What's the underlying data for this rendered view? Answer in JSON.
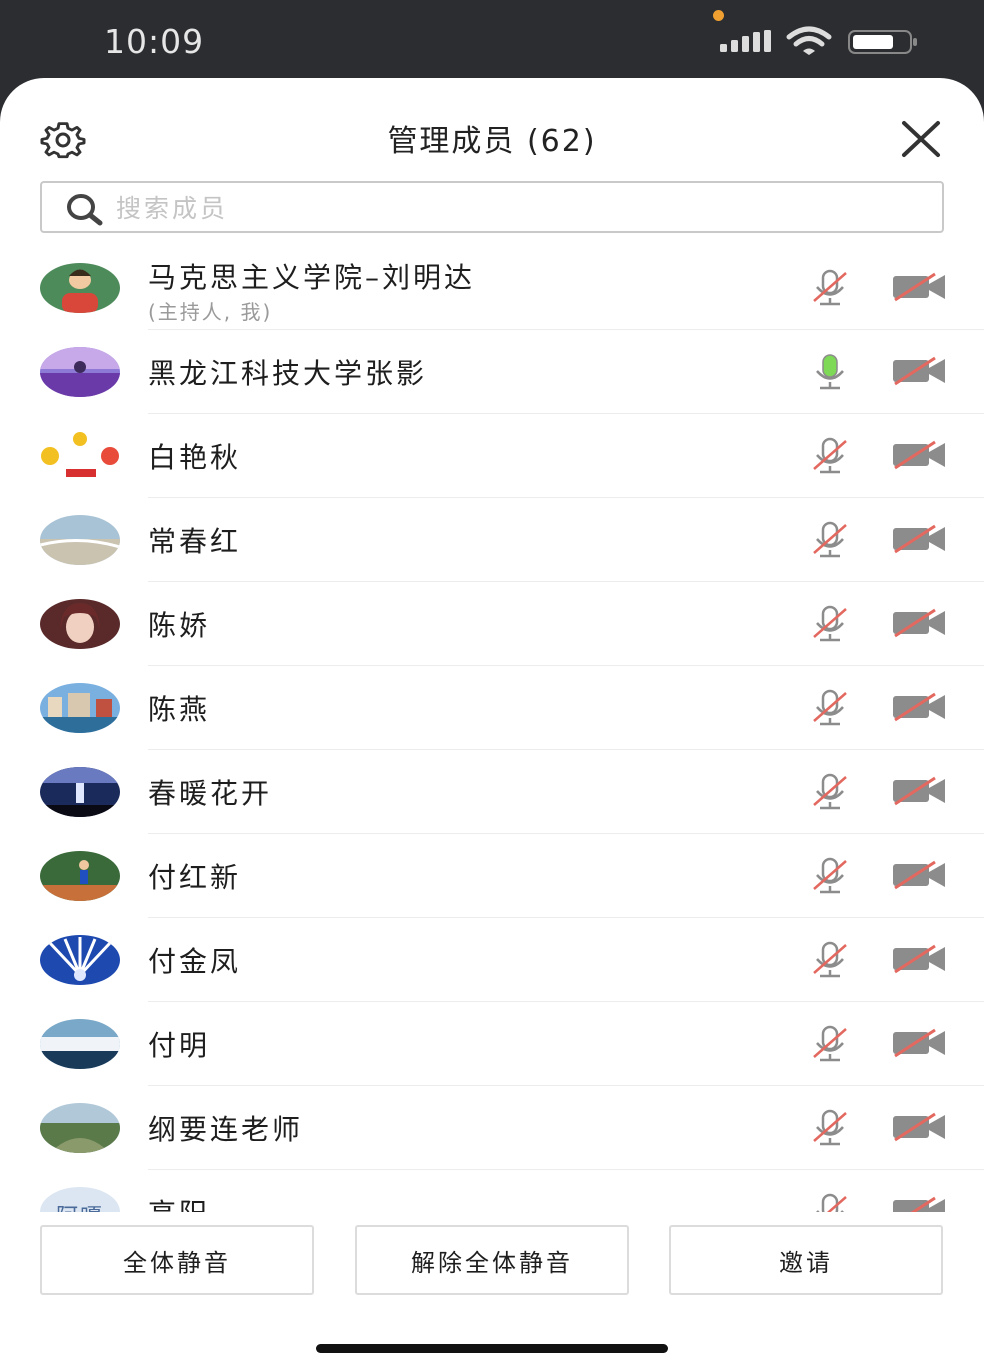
{
  "status_bar": {
    "time": "10:09"
  },
  "header": {
    "title": "管理成员 (62)"
  },
  "search": {
    "placeholder": "搜索成员"
  },
  "colors": {
    "mic_on": "#7ed957",
    "muted_slash": "#e3685f",
    "icon_gray": "#8c8c8c"
  },
  "members": [
    {
      "name": "马克思主义学院–刘明达",
      "subtitle": "(主持人, 我)",
      "mic": "muted",
      "camera": "off"
    },
    {
      "name": "黑龙江科技大学张影",
      "mic": "on",
      "camera": "off"
    },
    {
      "name": "白艳秋",
      "mic": "muted",
      "camera": "off"
    },
    {
      "name": "常春红",
      "mic": "muted",
      "camera": "off"
    },
    {
      "name": "陈娇",
      "mic": "muted",
      "camera": "off"
    },
    {
      "name": "陈燕",
      "mic": "muted",
      "camera": "off"
    },
    {
      "name": "春暖花开",
      "mic": "muted",
      "camera": "off"
    },
    {
      "name": "付红新",
      "mic": "muted",
      "camera": "off"
    },
    {
      "name": "付金凤",
      "mic": "muted",
      "camera": "off"
    },
    {
      "name": "付明",
      "mic": "muted",
      "camera": "off"
    },
    {
      "name": "纲要连老师",
      "mic": "muted",
      "camera": "off"
    },
    {
      "name": "高阳",
      "avatar_text": "阿嘎",
      "mic": "muted",
      "camera": "off"
    }
  ],
  "footer": {
    "mute_all_label": "全体静音",
    "unmute_all_label": "解除全体静音",
    "invite_label": "邀请"
  }
}
